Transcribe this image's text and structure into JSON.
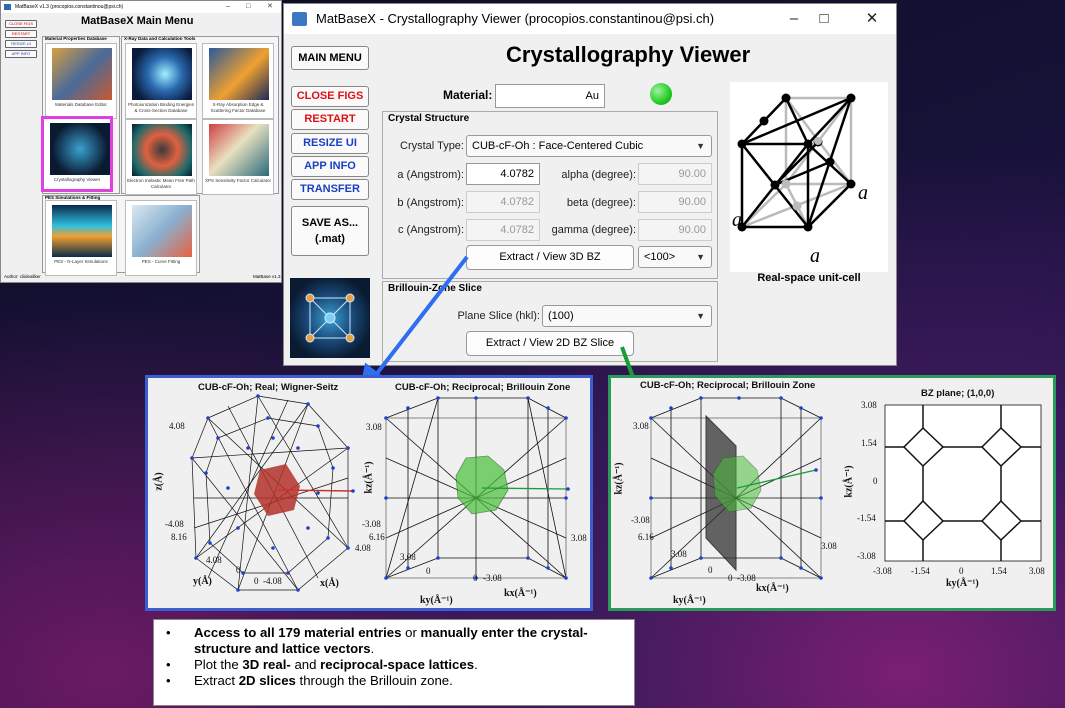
{
  "main_menu": {
    "title_bar": "MatBaseX v1.3 (procopios.constantinou@psi.ch)",
    "title": "MatBaseX Main Menu",
    "buttons": [
      "CLOSE FIGS",
      "RESTART",
      "RESIZE UI",
      "APP INFO"
    ],
    "groups": {
      "materials": "Material Properties Database",
      "xray": "X-Ray Data and Calculation Tools",
      "pes": "PES Simulations & Fitting"
    },
    "tiles": [
      "Materials Database Editor",
      "Photoionization Binding Energies & Cross-Section Database",
      "X-Ray Absorption Edge & Scattering Factor Database",
      "Crystallography Viewer",
      "Electron Inelastic Mean Free Path Calculator",
      "XPS Sensitivity Factor Calculator",
      "PES - N-Layer Simulations",
      "PES - Curve Fitting"
    ],
    "footer_left": "Author: cliideallker",
    "footer_right": "MatBase v1.3"
  },
  "viewer": {
    "window_title": "MatBaseX - Crystallography Viewer (procopios.constantinou@psi.ch)",
    "heading": "Crystallography Viewer",
    "side_buttons": {
      "main_menu": "MAIN MENU",
      "close_figs": "CLOSE FIGS",
      "restart": "RESTART",
      "resize_ui": "RESIZE UI",
      "app_info": "APP INFO",
      "transfer": "TRANSFER",
      "save_as_line1": "SAVE AS...",
      "save_as_line2": "(.mat)"
    },
    "material_label": "Material:",
    "material_value": "Au",
    "status_color": "#22cc22",
    "crystal_structure": {
      "title": "Crystal Structure",
      "type_label": "Crystal Type:",
      "type_value": "CUB-cF-Oh : Face-Centered Cubic",
      "a_label": "a (Angstrom):",
      "a_value": "4.0782",
      "b_label": "b (Angstrom):",
      "b_value": "4.0782",
      "c_label": "c (Angstrom):",
      "c_value": "4.0782",
      "alpha_label": "alpha (degree):",
      "alpha_value": "90.00",
      "beta_label": "beta (degree):",
      "beta_value": "90.00",
      "gamma_label": "gamma (degree):",
      "gamma_value": "90.00",
      "extract_3d": "Extract / View 3D BZ",
      "direction": "<100>"
    },
    "bz_slice": {
      "title": "Brillouin-Zone Slice",
      "plane_label": "Plane Slice (hkl):",
      "plane_value": "(100)",
      "extract_2d": "Extract / View 2D BZ Slice"
    },
    "unit_cell": {
      "caption": "Real-space unit-cell",
      "label_a": "a"
    }
  },
  "figure1": {
    "title_left": "CUB-cF-Oh; Real; Wigner-Seitz",
    "title_right": "CUB-cF-Oh; Reciprocal; Brillouin Zone",
    "left_ticks": {
      "z_top": "4.08",
      "z_bot": "-4.08",
      "y1": "8.16",
      "y2": "4.08",
      "y0": "0",
      "x0": "0",
      "xm": "-4.08",
      "x1": "4.08"
    },
    "left_axes": {
      "z": "z(Å)",
      "y": "y(Å)",
      "x": "x(Å)"
    },
    "right_ticks": {
      "kz_top": "3.08",
      "kz_bot": "-3.08",
      "ky1": "6.16",
      "ky2": "3.08",
      "ky0": "0",
      "kx0": "0",
      "kxm": "-3.08",
      "kx1": "3.08"
    },
    "right_axes": {
      "kz": "kz(Å⁻¹)",
      "ky": "ky(Å⁻¹)",
      "kx": "kx(Å⁻¹)"
    }
  },
  "figure2": {
    "title_left": "CUB-cF-Oh; Reciprocal; Brillouin Zone",
    "title_right": "BZ plane; (1,0,0)",
    "left_ticks": {
      "kz_top": "3.08",
      "kz_bot": "-3.08",
      "ky1": "6.16",
      "ky2": "3.08",
      "ky0": "0",
      "kx0": "0",
      "kxm": "-3.08",
      "kx1": "3.08"
    },
    "left_axes": {
      "kz": "kz(Å⁻¹)",
      "ky": "ky(Å⁻¹)",
      "kx": "kx(Å⁻¹)"
    },
    "right_yticks": [
      "3.08",
      "1.54",
      "0",
      "-1.54",
      "-3.08"
    ],
    "right_xticks": [
      "-3.08",
      "-1.54",
      "0",
      "1.54",
      "3.08"
    ],
    "right_axes": {
      "kz": "kz(Å⁻¹)",
      "ky": "ky(Å⁻¹)"
    }
  },
  "bullets": [
    {
      "b1": "Access to all 179 material entries",
      "n1": " or ",
      "b2": "manually enter the crystal-structure and lattice vectors",
      "n2": "."
    },
    {
      "n1": "Plot the ",
      "b1": "3D real-",
      "n2": " and ",
      "b2": "reciprocal-space lattices",
      "n3": "."
    },
    {
      "n1": "Extract ",
      "b1": "2D slices",
      "n2": " through the Brillouin zone."
    }
  ],
  "colors": {
    "arrow_blue": "#2f6ef0",
    "arrow_green": "#1a9c3a",
    "fig1_border": "#3a5fd0",
    "fig2_border": "#2a9a5a",
    "highlight": "#e040e0"
  }
}
